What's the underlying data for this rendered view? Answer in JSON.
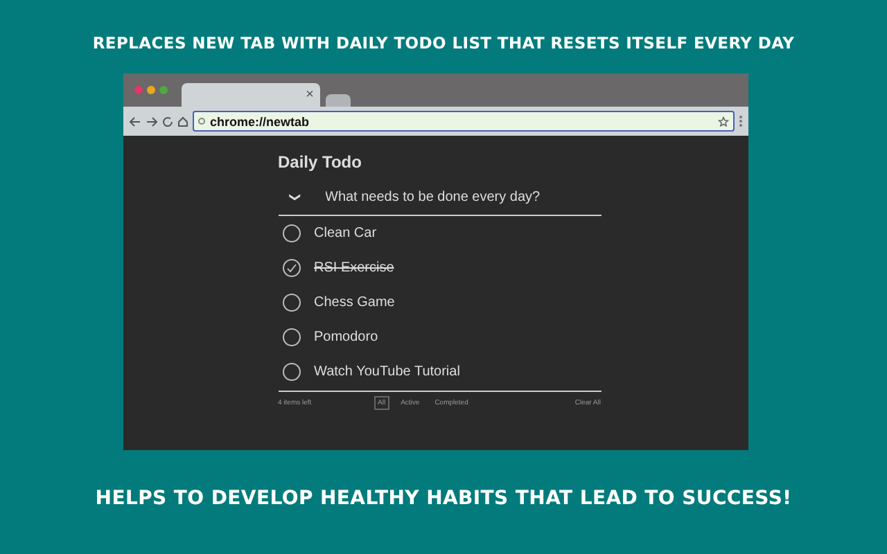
{
  "headline_top": "REPLACES NEW TAB WITH DAILY TODO LIST THAT RESETS ITSELF EVERY DAY",
  "browser": {
    "tabs": [
      {
        "selected": true,
        "close": "×"
      },
      {
        "selected": false
      }
    ],
    "address": "chrome://newtab"
  },
  "todo": {
    "title": "Daily Todo",
    "toggle": "❯",
    "placeholder": "What needs to be done every day?",
    "items": [
      {
        "text": "Clean Car",
        "checked": false
      },
      {
        "text": "RSI Exercise",
        "checked": true
      },
      {
        "text": "Chess Game",
        "checked": false
      },
      {
        "text": "Pomodoro",
        "checked": false
      },
      {
        "text": "Watch YouTube Tutorial",
        "checked": false
      }
    ],
    "count": "4 items left",
    "filters": [
      {
        "label": "All",
        "selected": true
      },
      {
        "label": "Active",
        "selected": false
      },
      {
        "label": "Completed",
        "selected": false
      }
    ],
    "clear": "Clear All"
  },
  "headline_bottom": "HELPS TO DEVELOP HEALTHY HABITS THAT LEAD TO SUCCESS!"
}
